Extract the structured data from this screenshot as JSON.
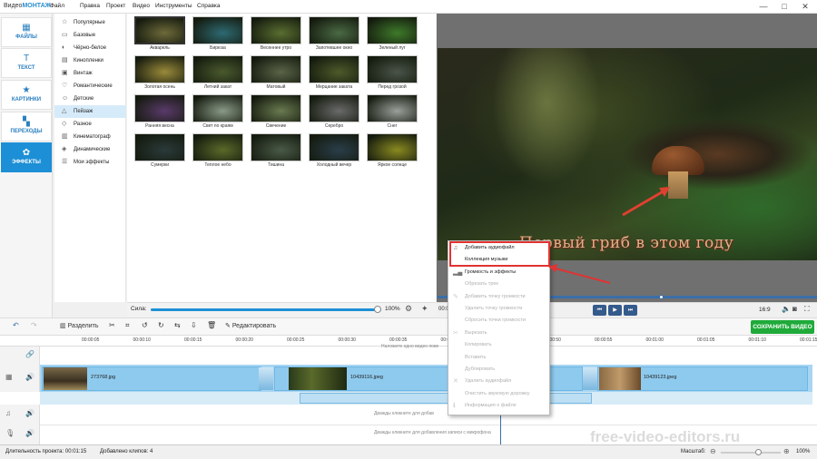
{
  "app": {
    "brand_prefix": "Видео",
    "brand_accent": "МОНТАЖ"
  },
  "menu": [
    "Файл",
    "Правка",
    "Проект",
    "Видео",
    "Инструменты",
    "Справка"
  ],
  "window_buttons": [
    "—",
    "□",
    "✕"
  ],
  "nav": [
    {
      "label": "ФАЙЛЫ",
      "icon": "files-icon",
      "glyph": "▦"
    },
    {
      "label": "ТЕКСТ",
      "icon": "text-icon",
      "glyph": "T"
    },
    {
      "label": "КАРТИНКИ",
      "icon": "star-icon",
      "glyph": "★"
    },
    {
      "label": "ПЕРЕХОДЫ",
      "icon": "transitions-icon",
      "glyph": "▚"
    },
    {
      "label": "ЭФФЕКТЫ",
      "icon": "effects-icon",
      "glyph": "✿"
    }
  ],
  "categories": [
    {
      "label": "Популярные",
      "glyph": "☆"
    },
    {
      "label": "Базовые",
      "glyph": "▭"
    },
    {
      "label": "Чёрно-белое",
      "glyph": "◐"
    },
    {
      "label": "Кинопленки",
      "glyph": "▤"
    },
    {
      "label": "Винтаж",
      "glyph": "▣"
    },
    {
      "label": "Романтические",
      "glyph": "♡"
    },
    {
      "label": "Детские",
      "glyph": "☺"
    },
    {
      "label": "Пейзаж",
      "glyph": "△"
    },
    {
      "label": "Разное",
      "glyph": "◇"
    },
    {
      "label": "Кинематограф",
      "glyph": "▥"
    },
    {
      "label": "Динамические",
      "glyph": "◈"
    },
    {
      "label": "Мои эффекты",
      "glyph": "☰"
    }
  ],
  "active_category": "Пейзаж",
  "effects": [
    {
      "label": "Акварель",
      "color": "#6e6a3a"
    },
    {
      "label": "Бирюза",
      "color": "#2e6a72"
    },
    {
      "label": "Весеннее утро",
      "color": "#5a6e30"
    },
    {
      "label": "Запотевшее окно",
      "color": "#4a6a44"
    },
    {
      "label": "Зеленый луг",
      "color": "#3e7a2a"
    },
    {
      "label": "Золотая осень",
      "color": "#9a8a3a"
    },
    {
      "label": "Летний закат",
      "color": "#4a5a2e"
    },
    {
      "label": "Матовый",
      "color": "#5a6448"
    },
    {
      "label": "Мерцание заката",
      "color": "#4e5a2a"
    },
    {
      "label": "Перед грозой",
      "color": "#4a5448"
    },
    {
      "label": "Ранняя весна",
      "color": "#5a3a6a"
    },
    {
      "label": "Свет по краям",
      "color": "#8a9a88"
    },
    {
      "label": "Свечение",
      "color": "#6a7a50"
    },
    {
      "label": "Серебро",
      "color": "#6a6a6a"
    },
    {
      "label": "Снег",
      "color": "#9aa09a"
    },
    {
      "label": "Сумерки",
      "color": "#2a3a3a"
    },
    {
      "label": "Теплое небо",
      "color": "#5a6a2a"
    },
    {
      "label": "Тишина",
      "color": "#4a5a48"
    },
    {
      "label": "Холодный вечер",
      "color": "#2a3e4a"
    },
    {
      "label": "Яркое солнце",
      "color": "#8a8a20"
    }
  ],
  "selected_effect": "Акварель",
  "strength": {
    "label": "Сила:",
    "value": "100%",
    "fraction": 1.0
  },
  "preview": {
    "caption": "Первый гриб в этом году",
    "aspect": "16:9",
    "position": "00:0"
  },
  "toolbar": {
    "split": "Разделить",
    "edit": "Редактировать",
    "save": "СОХРАНИТЬ ВИДЕО"
  },
  "ruler_ticks": [
    "00:00:05",
    "00:00:10",
    "00:00:15",
    "00:00:20",
    "00:00:25",
    "00:00:30",
    "00:00:35",
    "00:00:40",
    "00:00:45",
    "00:00:50",
    "00:00:55",
    "00:01:00",
    "00:01:05",
    "00:01:10",
    "00:01:15"
  ],
  "tracks": {
    "title_hint": "Наложите одно видео пове",
    "clips": [
      "273768.jpg",
      "10439116.jpeg",
      "10439123.jpeg"
    ],
    "audio_hint": "Дважды кликните для добав",
    "mic_hint": "Дважды кликните для добавления записи с микрофона"
  },
  "context_menu": [
    {
      "label": "Добавить аудиофайл",
      "glyph": "♫",
      "enabled": true
    },
    {
      "label": "Коллекция музыки",
      "glyph": "",
      "enabled": true
    },
    {
      "label": "Громкость и эффекты",
      "glyph": "▂▄",
      "enabled": true
    },
    {
      "label": "Обрезать трек",
      "glyph": "",
      "enabled": false
    },
    {
      "label": "Добавить точку громкости",
      "glyph": "✎",
      "enabled": false
    },
    {
      "label": "Удалить точку громкости",
      "glyph": "",
      "enabled": false
    },
    {
      "label": "Сбросить точки громкости",
      "glyph": "",
      "enabled": false
    },
    {
      "label": "Вырезать",
      "glyph": "✂",
      "enabled": false
    },
    {
      "label": "Копировать",
      "glyph": "",
      "enabled": false
    },
    {
      "label": "Вставить",
      "glyph": "",
      "enabled": false
    },
    {
      "label": "Дублировать",
      "glyph": "",
      "enabled": false
    },
    {
      "label": "Удалить аудиофайл",
      "glyph": "✕",
      "enabled": false
    },
    {
      "label": "Очистить звуковую дорожку",
      "glyph": "",
      "enabled": false
    },
    {
      "label": "Информация о файле",
      "glyph": "ℹ",
      "enabled": false
    }
  ],
  "status": {
    "duration": "Длительность проекта: 00:01:15",
    "clips": "Добавлено клипов: 4",
    "scale_label": "Масштаб:",
    "scale_value": "100%"
  },
  "watermark": "free-video-editors.ru",
  "colors": {
    "accent": "#1d8fd6",
    "save": "#1faa3a",
    "highlight": "#e23232"
  }
}
